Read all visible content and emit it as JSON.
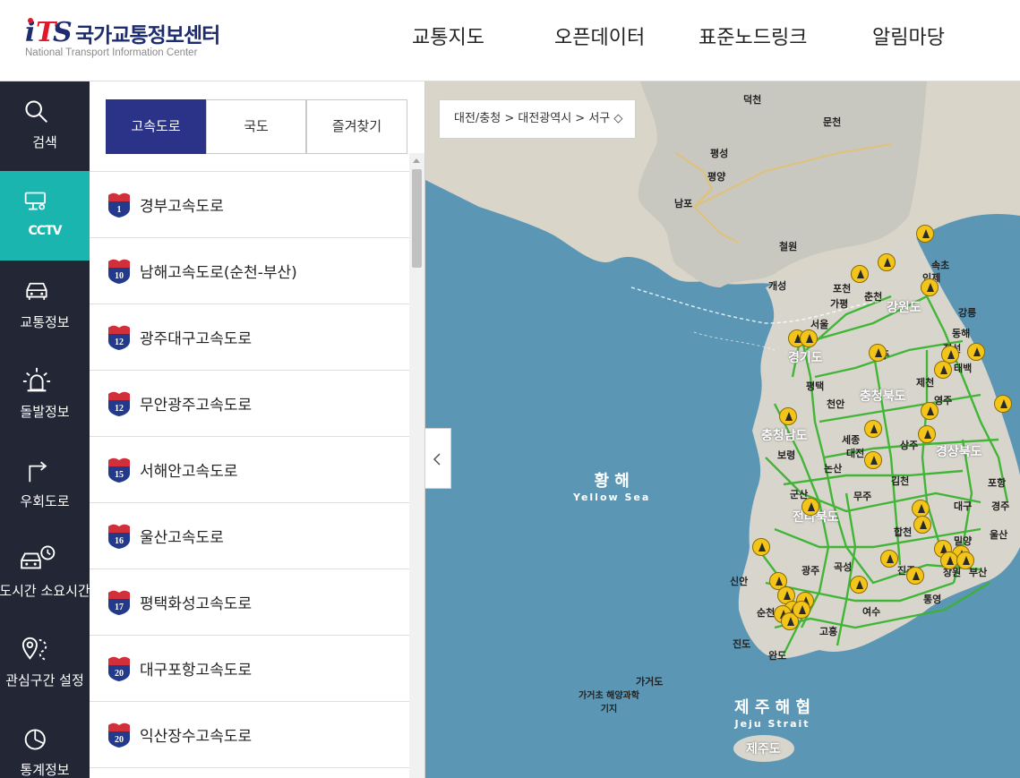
{
  "header": {
    "logo_mark": "iTS",
    "logo_title": "국가교통정보센터",
    "logo_subtitle": "National Transport Information Center",
    "nav": [
      "교통지도",
      "오픈데이터",
      "표준노드링크",
      "알림마당"
    ]
  },
  "rail": {
    "items": [
      {
        "label": "검색",
        "icon": "search-icon"
      },
      {
        "label": "CCTV",
        "icon": "cctv-icon",
        "active": true
      },
      {
        "label": "교통정보",
        "icon": "car-icon"
      },
      {
        "label": "돌발정보",
        "icon": "alert-light-icon"
      },
      {
        "label": "우회도로",
        "icon": "detour-icon"
      },
      {
        "label": "도시간 소요시간",
        "icon": "car-clock-icon"
      },
      {
        "label": "관심구간 설정",
        "icon": "route-pin-icon"
      },
      {
        "label": "통계정보",
        "icon": "pie-chart-icon"
      }
    ]
  },
  "panel": {
    "tabs": [
      "고속도로",
      "국도",
      "즐겨찾기"
    ],
    "active_tab": "고속도로",
    "roads": [
      {
        "num": "1",
        "name": "경부고속도로"
      },
      {
        "num": "10",
        "name": "남해고속도로(순천-부산)"
      },
      {
        "num": "12",
        "name": "광주대구고속도로"
      },
      {
        "num": "12",
        "name": "무안광주고속도로"
      },
      {
        "num": "15",
        "name": "서해안고속도로"
      },
      {
        "num": "16",
        "name": "울산고속도로"
      },
      {
        "num": "17",
        "name": "평택화성고속도로"
      },
      {
        "num": "20",
        "name": "대구포항고속도로"
      },
      {
        "num": "20",
        "name": "익산장수고속도로"
      }
    ]
  },
  "map": {
    "breadcrumb": "대전/충청 > 대전광역시 > 서구 ◇",
    "seas": [
      {
        "ko": "황 해",
        "en": "Yellow Sea"
      },
      {
        "ko": "제 주 해 협",
        "en": "Jeju Strait"
      }
    ],
    "places": [
      "덕천",
      "문천",
      "평성",
      "평양",
      "남포",
      "철원",
      "개성",
      "속초",
      "인제",
      "춘천",
      "포천",
      "가평",
      "원주",
      "강릉",
      "동해",
      "서울",
      "경기도",
      "강원도",
      "정선",
      "태백",
      "평택",
      "제천",
      "충청북도",
      "영주",
      "천안",
      "충청남도",
      "세종",
      "대전",
      "상주",
      "경상북도",
      "보령",
      "논산",
      "김천",
      "대구",
      "포항",
      "군산",
      "전라북도",
      "경주",
      "무주",
      "합천",
      "울산",
      "광주",
      "곡성",
      "진주",
      "밀양",
      "창원",
      "부산",
      "통영",
      "신안",
      "순천",
      "여수",
      "고흥",
      "진도",
      "완도",
      "가거도",
      "가거초 해양과학기지",
      "제주도"
    ],
    "colors": {
      "road": "#3ab431",
      "marker": "#f3c51b",
      "sea": "#5b97b5",
      "land": "#d9d7cf"
    }
  }
}
